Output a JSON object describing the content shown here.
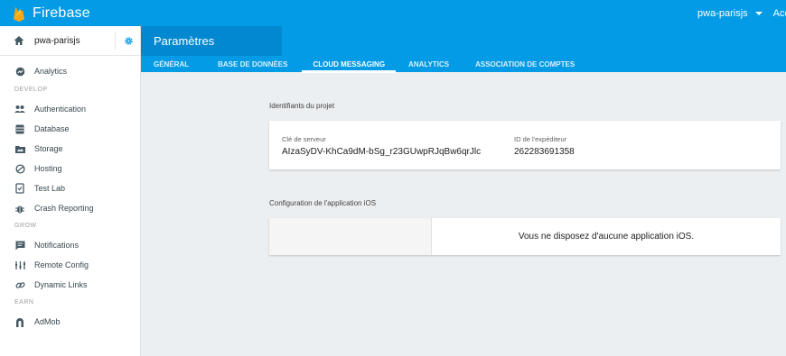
{
  "app": {
    "title": "Firebase"
  },
  "account": {
    "project_selected": "pwa-parisjs",
    "account_label": "Acc"
  },
  "sidebar": {
    "project_name": "pwa-parisjs",
    "items_top": [
      {
        "label": "Analytics",
        "icon": "analytics-icon"
      }
    ],
    "sections": [
      {
        "title": "DEVELOP",
        "items": [
          {
            "label": "Authentication",
            "icon": "people-icon"
          },
          {
            "label": "Database",
            "icon": "database-icon"
          },
          {
            "label": "Storage",
            "icon": "folder-icon"
          },
          {
            "label": "Hosting",
            "icon": "globe-icon"
          },
          {
            "label": "Test Lab",
            "icon": "test-lab-icon"
          },
          {
            "label": "Crash Reporting",
            "icon": "bug-icon"
          }
        ]
      },
      {
        "title": "GROW",
        "items": [
          {
            "label": "Notifications",
            "icon": "message-icon"
          },
          {
            "label": "Remote Config",
            "icon": "remote-config-icon"
          },
          {
            "label": "Dynamic Links",
            "icon": "link-icon"
          }
        ]
      },
      {
        "title": "EARN",
        "items": [
          {
            "label": "AdMob",
            "icon": "admob-icon"
          }
        ]
      }
    ]
  },
  "page": {
    "title": "Paramètres",
    "tabs": [
      {
        "label": "GÉNÉRAL",
        "active": false
      },
      {
        "label": "BASE DE DONNÉES",
        "active": false
      },
      {
        "label": "CLOUD MESSAGING",
        "active": true
      },
      {
        "label": "ANALYTICS",
        "active": false
      },
      {
        "label": "ASSOCIATION DE COMPTES",
        "active": false
      }
    ]
  },
  "credentials": {
    "section_title": "Identifiants du projet",
    "server_key_label": "Clé de serveur",
    "server_key_value": "AIzaSyDV-KhCa9dM-bSg_r23GUwpRJqBw6qrJlc",
    "sender_id_label": "ID de l'expéditeur",
    "sender_id_value": "262283691358"
  },
  "ios": {
    "section_title": "Configuration de l'application iOS",
    "empty_message": "Vous ne disposez d'aucune application iOS."
  },
  "colors": {
    "primary": "#039be5",
    "primary_dark": "#0288d1",
    "background": "#eceff1"
  }
}
